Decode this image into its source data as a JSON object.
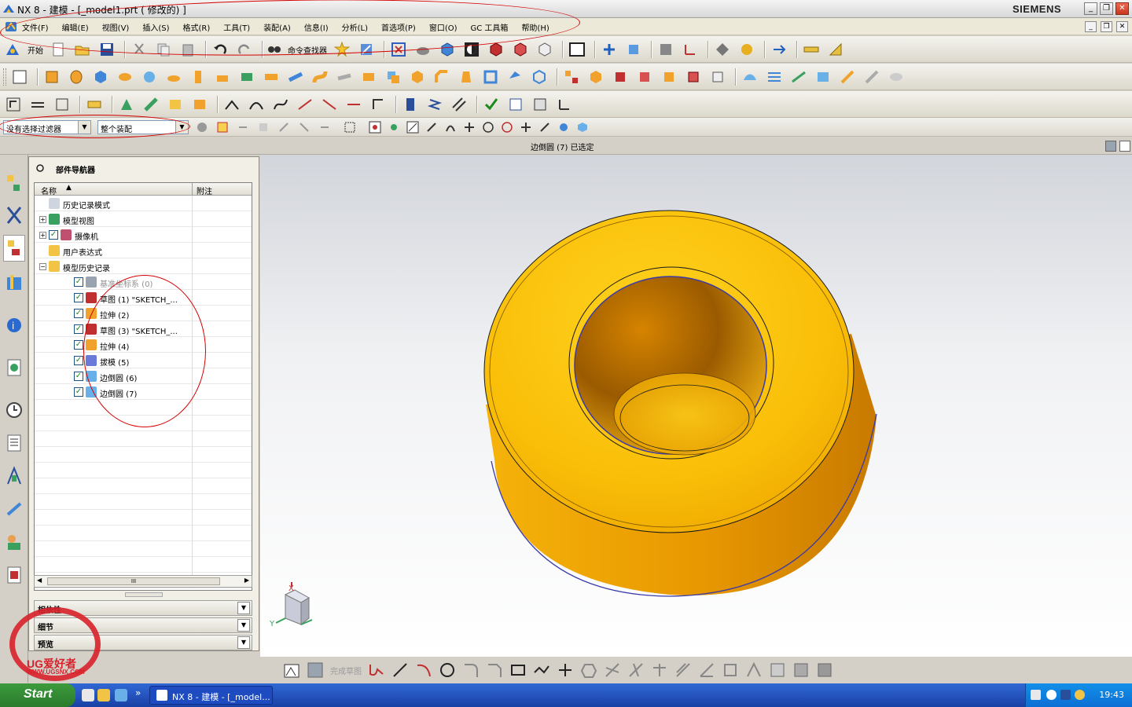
{
  "window": {
    "title": "NX 8 - 建模 - [_model1.prt ( 修改的) ]",
    "brand": "SIEMENS",
    "buttons": {
      "minimize": "_",
      "restore": "❐",
      "close": "✕"
    }
  },
  "menubar": {
    "items": [
      "文件(F)",
      "编辑(E)",
      "视图(V)",
      "插入(S)",
      "格式(R)",
      "工具(T)",
      "装配(A)",
      "信息(I)",
      "分析(L)",
      "首选项(P)",
      "窗口(O)",
      "GC 工具箱",
      "帮助(H)"
    ]
  },
  "toolbar": {
    "start_label": "开始",
    "command_finder_label": "命令查找器"
  },
  "selection_bar": {
    "filter_value": "没有选择过滤器",
    "scope_value": "整个装配"
  },
  "status": {
    "message": "边倒圆 (7)  已选定"
  },
  "navigator": {
    "title": "部件导航器",
    "columns": [
      "名称",
      "附注"
    ],
    "rows": [
      {
        "label": "历史记录模式",
        "indent": 1,
        "type": "clock",
        "expander": "",
        "checked": false,
        "dim": false
      },
      {
        "label": "模型视图",
        "indent": 1,
        "type": "view",
        "expander": "+",
        "checked": false,
        "dim": false
      },
      {
        "label": "摄像机",
        "indent": 1,
        "type": "camera",
        "expander": "+",
        "checked": true,
        "dim": false
      },
      {
        "label": "用户表达式",
        "indent": 1,
        "type": "folder",
        "expander": "",
        "checked": false,
        "dim": false
      },
      {
        "label": "模型历史记录",
        "indent": 1,
        "type": "folder",
        "expander": "−",
        "checked": false,
        "dim": false
      },
      {
        "label": "基准坐标系 (0)",
        "indent": 2,
        "type": "datum",
        "expander": "",
        "checked": true,
        "dim": true
      },
      {
        "label": "草图 (1) \"SKETCH_...",
        "indent": 2,
        "type": "sketch",
        "expander": "",
        "checked": true,
        "dim": false
      },
      {
        "label": "拉伸 (2)",
        "indent": 2,
        "type": "extrude",
        "expander": "",
        "checked": true,
        "dim": false
      },
      {
        "label": "草图 (3) \"SKETCH_...",
        "indent": 2,
        "type": "sketch",
        "expander": "",
        "checked": true,
        "dim": false
      },
      {
        "label": "拉伸 (4)",
        "indent": 2,
        "type": "extrude",
        "expander": "",
        "checked": true,
        "dim": false
      },
      {
        "label": "拔模 (5)",
        "indent": 2,
        "type": "draft",
        "expander": "",
        "checked": true,
        "dim": false
      },
      {
        "label": "边倒圆 (6)",
        "indent": 2,
        "type": "blend",
        "expander": "",
        "checked": true,
        "dim": false
      },
      {
        "label": "边倒圆 (7)",
        "indent": 2,
        "type": "blend",
        "expander": "",
        "checked": true,
        "dim": false
      }
    ],
    "panels": [
      "相依性",
      "细节",
      "预览"
    ],
    "scroll_label": "III"
  },
  "graphics": {
    "triad": {
      "x_label": "X",
      "y_label": "Y"
    },
    "part_color": "#f4b000",
    "edge_color": "#2020a0"
  },
  "sketch_toolbar": {
    "finish_label": "完成草图"
  },
  "taskbar": {
    "start": "Start",
    "task_label": "NX 8 - 建模 - [_model...",
    "clock": "19:43"
  },
  "watermark": {
    "main": "UG爱好者",
    "url": "WWW.UGSNX.COM"
  }
}
